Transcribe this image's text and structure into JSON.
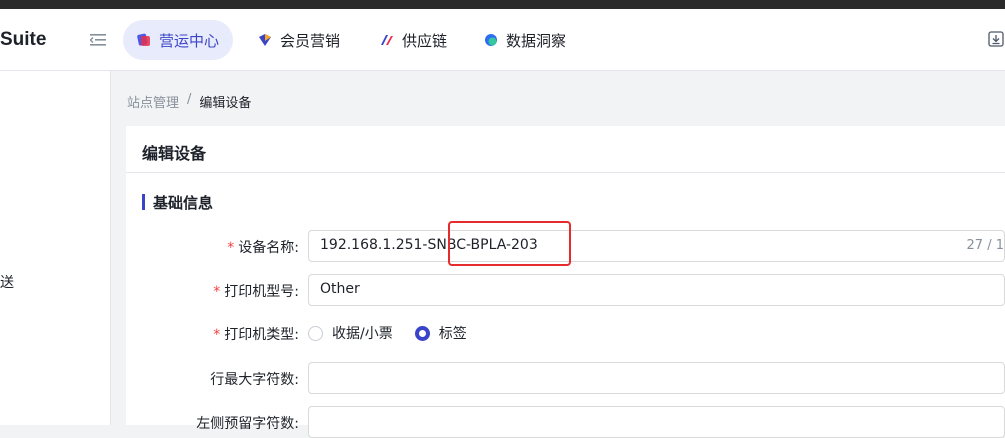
{
  "header": {
    "brand": "Suite",
    "nav": [
      {
        "label": "营运中心",
        "icon": "operations-icon",
        "active": true
      },
      {
        "label": "会员营销",
        "icon": "member-marketing-icon",
        "active": false
      },
      {
        "label": "供应链",
        "icon": "supply-chain-icon",
        "active": false
      },
      {
        "label": "数据洞察",
        "icon": "data-insight-icon",
        "active": false
      }
    ]
  },
  "sidebar": {
    "visible_text": "送"
  },
  "breadcrumb": {
    "parent": "站点管理",
    "separator": "/",
    "current": "编辑设备"
  },
  "card": {
    "title": "编辑设备",
    "section_title": "基础信息"
  },
  "form": {
    "device_name": {
      "label": "设备名称:",
      "value": "192.168.1.251-SNBC-BPLA-203",
      "counter": "27 / 1"
    },
    "printer_model": {
      "label": "打印机型号:",
      "value": "Other"
    },
    "printer_type": {
      "label": "打印机类型:",
      "options": [
        "收据/小票",
        "标签"
      ],
      "selected": "标签"
    },
    "max_chars": {
      "label": "行最大字符数:",
      "value": ""
    },
    "left_reserved": {
      "label": "左侧预留字符数:",
      "value": ""
    }
  },
  "colors": {
    "accent": "#3a44c8",
    "required": "#f53f3f",
    "highlight": "#e52b2b"
  }
}
